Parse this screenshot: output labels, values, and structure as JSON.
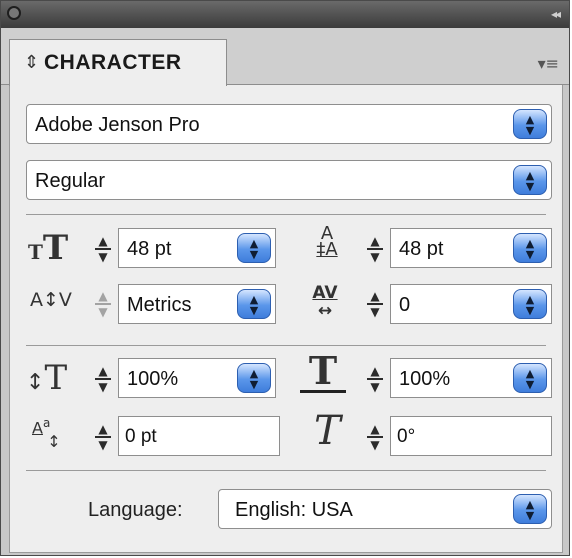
{
  "panel": {
    "tab_title": "CHARACTER"
  },
  "font": {
    "family": "Adobe Jenson Pro",
    "style": "Regular"
  },
  "controls": {
    "font_size": "48 pt",
    "leading": "48 pt",
    "kerning": "Metrics",
    "tracking": "0",
    "vertical_scale": "100%",
    "horizontal_scale": "100%",
    "baseline_shift": "0 pt",
    "skew": "0°"
  },
  "language": {
    "label": "Language:",
    "value": "English: USA"
  },
  "icons": [
    "close-icon",
    "collapse-icon",
    "tab-arrows-icon",
    "panel-menu-icon",
    "font-size-icon",
    "leading-icon",
    "kerning-icon",
    "tracking-icon",
    "vertical-scale-icon",
    "horizontal-scale-icon",
    "baseline-shift-icon",
    "skew-icon"
  ],
  "colors": {
    "accent": "#5a96ea",
    "title_bar": "#3b3b3b",
    "top_strip": "#a83a72"
  }
}
